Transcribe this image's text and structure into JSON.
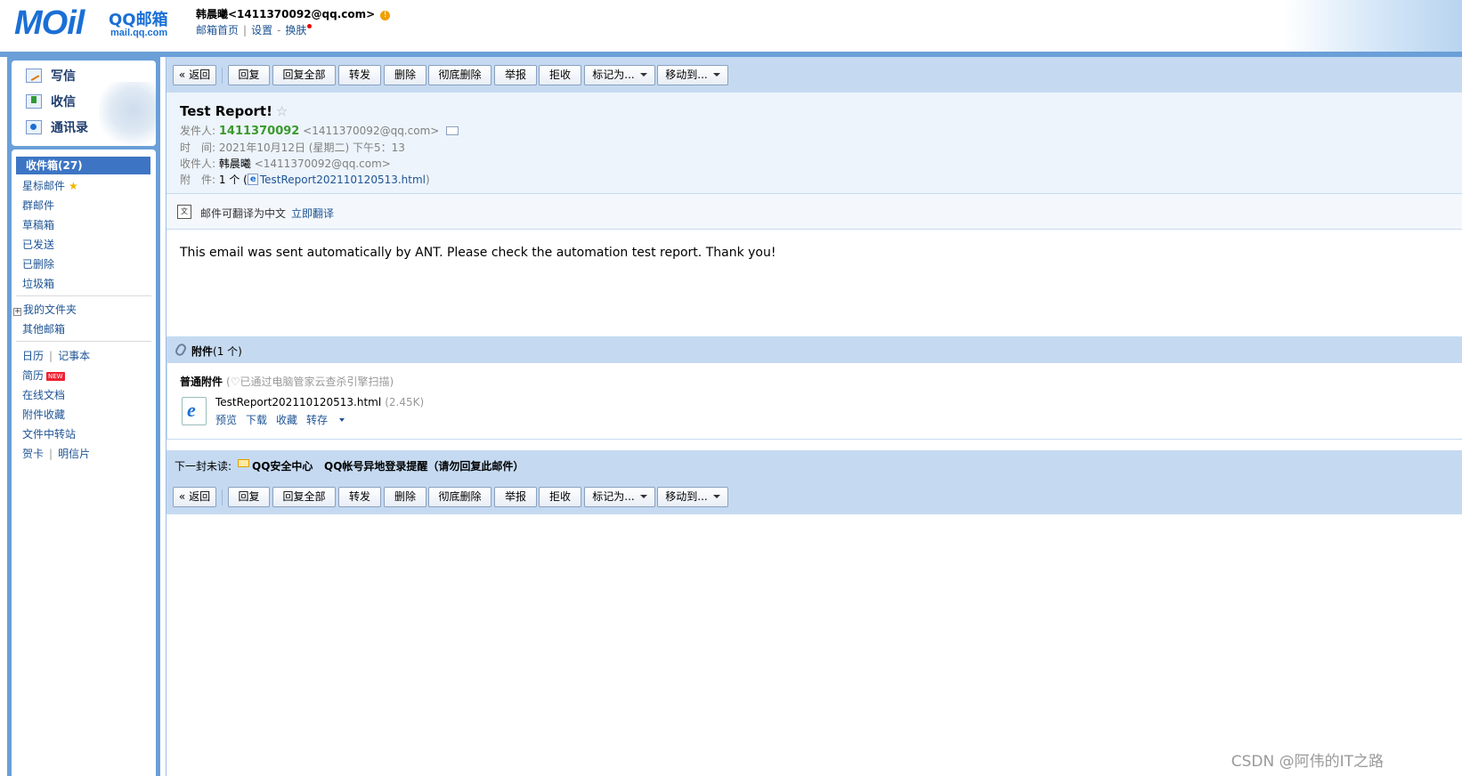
{
  "header": {
    "logo_text": "MOil",
    "logo_brand": "QQ邮箱",
    "logo_domain": "mail.qq.com",
    "user_display": "韩晨曦<1411370092@qq.com>",
    "links": [
      "邮箱首页",
      "设置",
      "换肤"
    ]
  },
  "sidebar": {
    "actions": [
      {
        "label": "写信",
        "icon": "compose-icon"
      },
      {
        "label": "收信",
        "icon": "receive-icon"
      },
      {
        "label": "通讯录",
        "icon": "contacts-icon"
      }
    ],
    "folders": [
      {
        "label": "收件箱(27)",
        "selected": true
      },
      {
        "label": "星标邮件"
      },
      {
        "label": "群邮件"
      },
      {
        "label": "草稿箱"
      },
      {
        "label": "已发送"
      },
      {
        "label": "已删除"
      },
      {
        "label": "垃圾箱"
      }
    ],
    "my_folders": "我的文件夹",
    "other_mail": "其他邮箱",
    "tools": {
      "calendar": "日历",
      "notebook": "记事本",
      "resume": "简历",
      "resume_badge": "NEW",
      "online_docs": "在线文档",
      "attach_fav": "附件收藏",
      "file_transfer": "文件中转站",
      "greeting_card": "贺卡",
      "postcard": "明信片"
    }
  },
  "toolbar": {
    "back": "« 返回",
    "reply": "回复",
    "reply_all": "回复全部",
    "forward": "转发",
    "delete": "删除",
    "delete_perm": "彻底删除",
    "report": "举报",
    "reject": "拒收",
    "mark_as": "标记为...",
    "move_to": "移动到..."
  },
  "mail": {
    "subject": "Test Report!",
    "from_label": "发件人:",
    "from_name": "1411370092",
    "from_addr": "<1411370092@qq.com>",
    "time_label": "时　间:",
    "time_value": "2021年10月12日 (星期二) 下午5：13",
    "to_label": "收件人:",
    "to_name": "韩晨曦",
    "to_addr": "<1411370092@qq.com>",
    "attach_label": "附　件:",
    "attach_count": "1 个 (",
    "attach_file": "TestReport202110120513.html",
    "attach_close": ")",
    "body": "This email was sent automatically by ANT. Please check the automation test report. Thank you!"
  },
  "translate": {
    "text": "邮件可翻译为中文",
    "link": "立即翻译"
  },
  "attachments": {
    "title": "附件",
    "count": "(1 个)",
    "kind": "普通附件",
    "scan_note": "(♡已通过电脑管家云查杀引擎扫描)",
    "file_name": "TestReport202110120513.html",
    "file_size": "(2.45K)",
    "actions": [
      "预览",
      "下载",
      "收藏",
      "转存"
    ]
  },
  "next_unread": {
    "label": "下一封未读:",
    "from": "QQ安全中心",
    "subject": "QQ帐号异地登录提醒（请勿回复此邮件）"
  },
  "watermark": "CSDN @阿伟的IT之路",
  "colors": {
    "brand_blue": "#1a6fd6",
    "toolbar_bg": "#c5daf1",
    "selected_folder": "#3d75c4",
    "sender_green": "#3a9a2c",
    "link": "#1e5494"
  }
}
